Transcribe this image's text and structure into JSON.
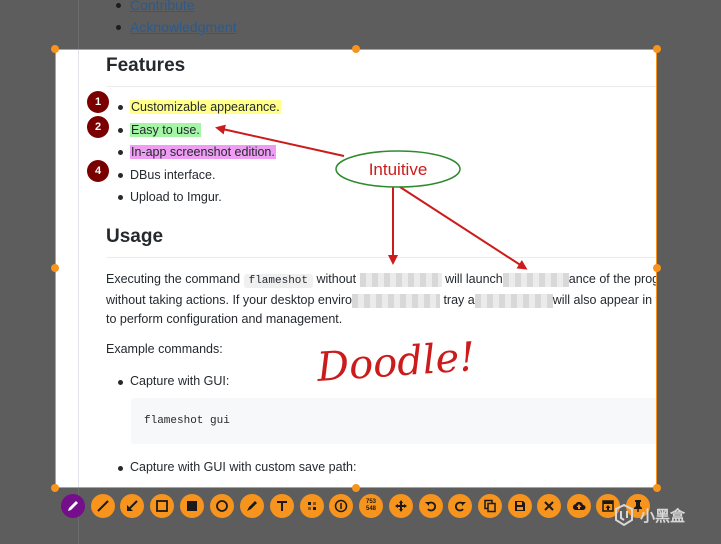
{
  "background_doc": {
    "links": [
      "Contribute",
      "Acknowledgment"
    ]
  },
  "features": {
    "heading": "Features",
    "items": [
      {
        "text": "Customizable appearance.",
        "highlight": "#ffff8a",
        "marker": "1"
      },
      {
        "text": "Easy to use.",
        "highlight": "#a6f5a6",
        "marker": "2"
      },
      {
        "text": "In-app screenshot edition.",
        "highlight": "#ef9cf3",
        "marker": ""
      },
      {
        "text": "DBus interface.",
        "highlight": "",
        "marker": "4"
      },
      {
        "text": "Upload to Imgur.",
        "highlight": "",
        "marker": ""
      }
    ]
  },
  "usage": {
    "heading": "Usage",
    "para_line1_a": "Executing the command",
    "para_code": "flameshot",
    "para_line1_b": "without",
    "para_line1_c": "will launch",
    "para_line1_d": "ance of the program in back",
    "para_line2_a": "without taking actions. If your desktop enviro",
    "para_line2_b": "tray a",
    "para_line2_c": "will also appear",
    "para_line2_d": "in the tray f",
    "para_line3": "to perform configuration and management.",
    "example_label": "Example commands:",
    "cmd1_label": "Capture with GUI:",
    "cmd1_code": "flameshot gui",
    "cmd2_label": "Capture with GUI with custom save path:"
  },
  "annotations": {
    "callout": "Intuitive",
    "doodle": "Doodle!",
    "callout_color": "#cc1b1b",
    "ellipse_color": "#2f8a2f",
    "marker_color": "#7a0000"
  },
  "toolbar": {
    "selection_size_w": "753",
    "selection_size_h": "548",
    "accent": "#f7941d",
    "active": "#740e8a",
    "tools": [
      "pencil-tool",
      "line-tool",
      "arrow-tool",
      "rectangle-tool",
      "filled-rectangle-tool",
      "circle-tool",
      "marker-tool",
      "text-tool",
      "pixelate-tool",
      "circle-counter-tool",
      "selection-size",
      "move-tool",
      "undo-tool",
      "redo-tool",
      "copy-tool",
      "save-tool",
      "exit-tool",
      "upload-tool",
      "launcher-tool",
      "pin-tool"
    ]
  },
  "watermark": {
    "text": "小黑盒"
  }
}
